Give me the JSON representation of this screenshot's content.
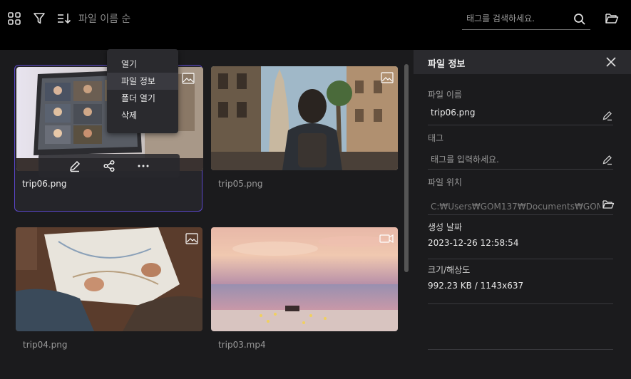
{
  "toolbar": {
    "sort_label": "파일 이름 순",
    "search_placeholder": "태그를 검색하세요.",
    "icons": [
      "grid-view-icon",
      "filter-icon",
      "sort-icon",
      "search-icon",
      "folder-open-icon"
    ]
  },
  "files": [
    {
      "name": "trip06.png",
      "type": "image",
      "selected": true
    },
    {
      "name": "trip05.png",
      "type": "image",
      "selected": false
    },
    {
      "name": "trip04.png",
      "type": "image",
      "selected": false
    },
    {
      "name": "trip03.mp4",
      "type": "video",
      "selected": false
    }
  ],
  "context_menu": {
    "items": [
      "열기",
      "파일 정보",
      "폴더 열기",
      "삭제"
    ],
    "active": "파일 정보"
  },
  "hover_actions": [
    "edit-icon",
    "share-icon",
    "more-icon"
  ],
  "info_panel": {
    "title": "파일 정보",
    "file_name_label": "파일 이름",
    "file_name": "trip06.png",
    "tag_label": "태그",
    "tag_placeholder": "태그를 입력하세요.",
    "location_label": "파일 위치",
    "location": "C:₩Users₩GOM137₩Documents₩GOM",
    "created_label": "생성 날짜",
    "created": "2023-12-26  12:58:54",
    "size_label": "크기/해상도",
    "size": "992.23  KB  /  1143x637"
  },
  "colors": {
    "accent": "#5a46c8",
    "panel_bg": "#1b1b1d",
    "header_bg": "#2a2a2e"
  }
}
